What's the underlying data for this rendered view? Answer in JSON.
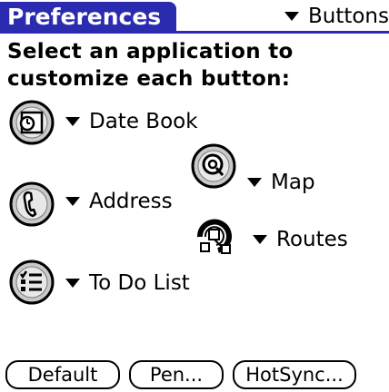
{
  "header": {
    "title": "Preferences",
    "category": "Buttons"
  },
  "instructions": {
    "line1": "Select an application to",
    "line2": "customize each button:"
  },
  "buttons": [
    {
      "icon": "calendar-icon",
      "app": "Date Book"
    },
    {
      "icon": "map-icon",
      "app": "Map"
    },
    {
      "icon": "phone-icon",
      "app": "Address"
    },
    {
      "icon": "routes-icon",
      "app": "Routes"
    },
    {
      "icon": "checklist-icon",
      "app": "To Do List"
    }
  ],
  "footer": {
    "default_label": "Default",
    "pen_label": "Pen...",
    "hotsync_label": "HotSync..."
  }
}
